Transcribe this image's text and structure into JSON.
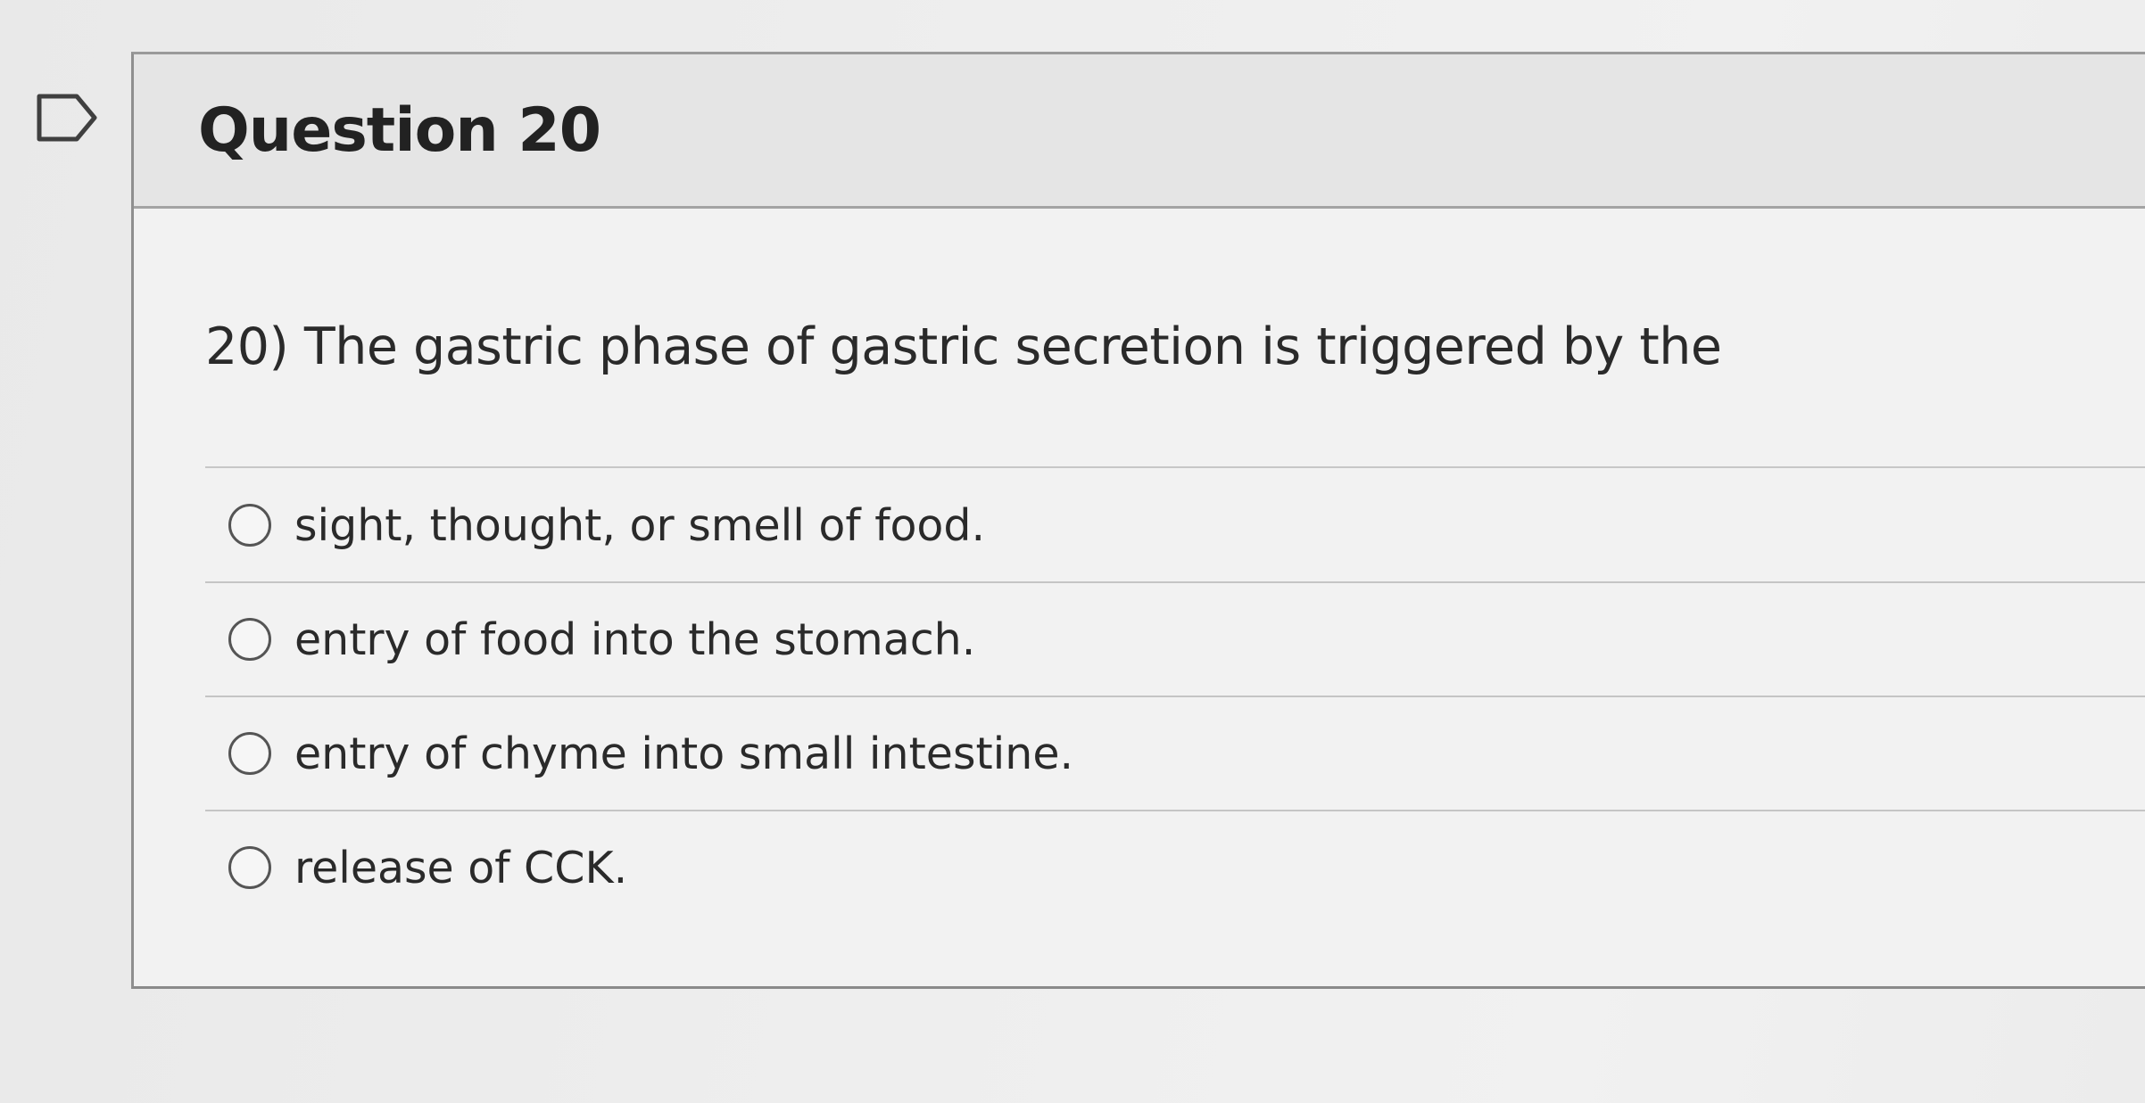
{
  "question": {
    "title": "Question 20",
    "text": "20) The gastric phase of gastric secretion is triggered by the",
    "answers": [
      {
        "label": "sight, thought, or smell of food."
      },
      {
        "label": "entry of food into the stomach."
      },
      {
        "label": "entry of chyme into small intestine."
      },
      {
        "label": "release of CCK."
      }
    ]
  },
  "icons": {
    "flag": "bookmark-flag-icon",
    "radio": "radio-button-icon"
  },
  "colors": {
    "background": "#ececec",
    "header_background": "#e5e5e5",
    "border": "#8f8f8f",
    "text": "#222222"
  }
}
